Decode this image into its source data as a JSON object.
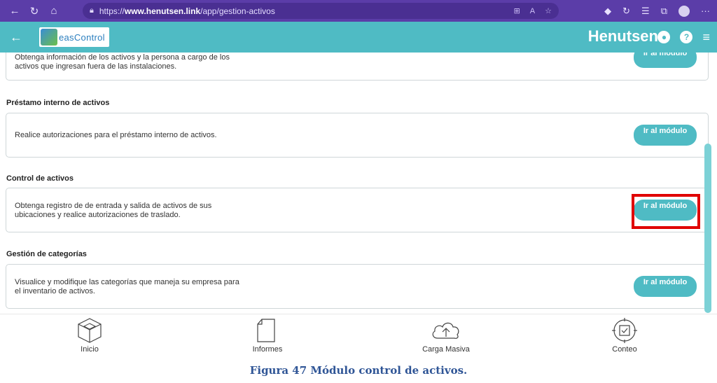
{
  "browser": {
    "url_prefix": "https://",
    "url_host": "www.henutsen.link",
    "url_path": "/app/gestion-activos",
    "more": "···"
  },
  "header": {
    "logo_text": "easControl",
    "brand": "Henutsen"
  },
  "sections": [
    {
      "title": "",
      "description": "Obtenga información de los activos y la persona a cargo de los activos que ingresan fuera de las  instalaciones.",
      "button": "Ir al módulo"
    },
    {
      "title": "Préstamo interno de activos",
      "description": "Realice autorizaciones para el préstamo interno  de activos.",
      "button": "Ir al módulo"
    },
    {
      "title": "Control de activos",
      "description": "Obtenga registro de de entrada y salida de activos de sus ubicaciones y realice autorizaciones de traslado.",
      "button": "Ir al módulo",
      "highlighted": true
    },
    {
      "title": "Gestión de categorías",
      "description": "Visualice y modifique las categorías que maneja su empresa para el inventario de activos.",
      "button": "Ir al módulo"
    }
  ],
  "tabbar": {
    "tabs": [
      {
        "label": "Inicio",
        "icon": "cube-icon"
      },
      {
        "label": "Informes",
        "icon": "document-icon"
      },
      {
        "label": "Carga Masiva",
        "icon": "cloud-upload-icon"
      },
      {
        "label": "Conteo",
        "icon": "target-check-icon"
      }
    ]
  },
  "caption": "Figura 47 Módulo control de activos.",
  "colors": {
    "browser": "#5b3da8",
    "teal": "#4fbbc4",
    "highlight": "#e00000",
    "caption": "#2f5596"
  }
}
